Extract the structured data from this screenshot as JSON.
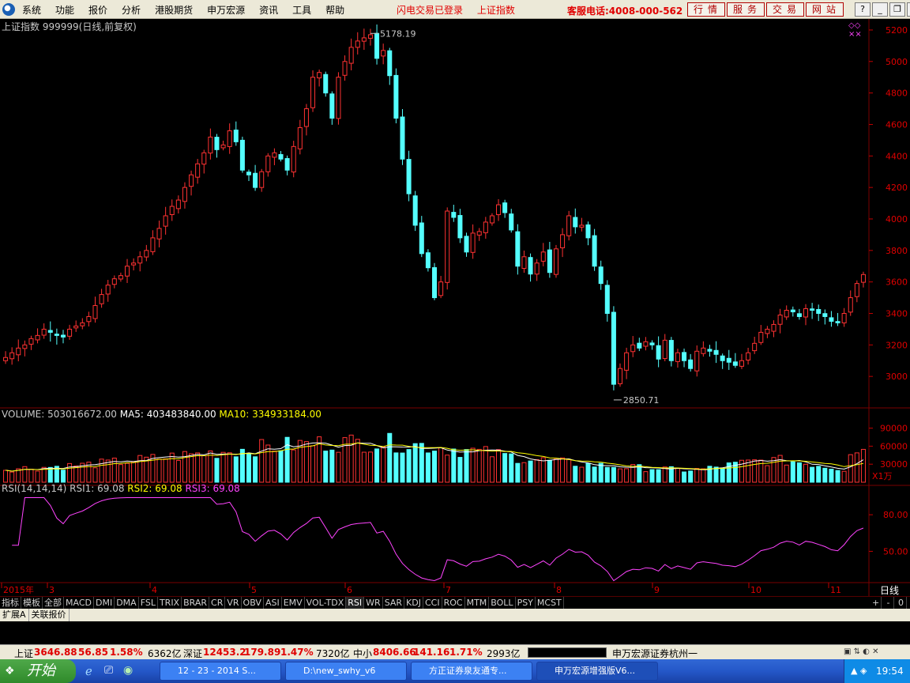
{
  "menu": [
    "系统",
    "功能",
    "报价",
    "分析",
    "港股期货",
    "申万宏源",
    "资讯",
    "工具",
    "帮助"
  ],
  "status_texts": [
    "闪电交易已登录",
    "上证指数"
  ],
  "hotline": "客服电话:4008-000-562",
  "top_buttons": [
    "行情",
    "服务",
    "交易",
    "网站"
  ],
  "window_controls": [
    "?",
    "_",
    "❐",
    "✕"
  ],
  "chart_header": {
    "title": "上证指数",
    "code": "999999(日线,前复权)",
    "high_label": "5178.19",
    "low_label": "2850.71"
  },
  "volume_header": {
    "volume": "VOLUME: 503016672.00",
    "ma5": "MA5: 403483840.00",
    "ma10": "MA10: 334933184.00",
    "unit": "X1万"
  },
  "rsi_header": {
    "name": "RSI(14,14,14)",
    "rsi1": "RSI1: 69.08",
    "rsi2": "RSI2: 69.08",
    "rsi3": "RSI3: 69.08"
  },
  "period_label": "日线",
  "colors": {
    "up": "#ff3232",
    "down": "#54ffff",
    "grid": "#7a0000",
    "rsi": "#ff44ff",
    "ma10": "#ffff00",
    "ma5": "#ffffff"
  },
  "tabs": [
    "指标",
    "模板",
    "全部",
    "MACD",
    "DMI",
    "DMA",
    "FSL",
    "TRIX",
    "BRAR",
    "CR",
    "VR",
    "OBV",
    "ASI",
    "EMV",
    "VOL-TDX",
    "RSI",
    "WR",
    "SAR",
    "KDJ",
    "CCI",
    "ROC",
    "MTM",
    "BOLL",
    "PSY",
    "MCST"
  ],
  "active_tab": "RSI",
  "tab_controls": [
    "+",
    "-",
    "0"
  ],
  "subtabs": [
    "扩展A",
    "关联报价"
  ],
  "statusbar": {
    "sh_label": "上证",
    "sh_value": "3646.88",
    "sh_change": "56.85",
    "sh_pct": "1.58%",
    "sh_amount": "6362亿",
    "sz_label": "深证",
    "sz_value": "12453.2",
    "sz_change": "179.89",
    "sz_pct": "1.47%",
    "sz_amount": "7320亿",
    "zx_label": "中小",
    "zx_value": "8406.66",
    "zx_change": "141.16",
    "zx_pct": "1.71%",
    "zx_amount": "2993亿",
    "broker": "申万宏源证券杭州一"
  },
  "taskbar": {
    "start": "开始",
    "windows": [
      "12 - 23 - 2014 S...",
      "D:\\new_swhy_v6",
      "方正证券泉友通专...",
      "申万宏源增强版V6..."
    ],
    "time": "19:54"
  },
  "chart_data": [
    {
      "type": "candlestick",
      "title": "上证指数 999999(日线,前复权)",
      "y_ticks": [
        3000,
        3200,
        3400,
        3600,
        3800,
        4000,
        4200,
        4400,
        4600,
        4800,
        5000,
        5200
      ],
      "ylim": [
        2800,
        5270
      ],
      "x_ticks": [
        "2015年",
        "3",
        "4",
        "5",
        "6",
        "7",
        "8",
        "9",
        "10",
        "11"
      ],
      "annotations": [
        {
          "label": "5178.19",
          "value": 5178.19
        },
        {
          "label": "2850.71",
          "value": 2850.71
        }
      ],
      "closes": [
        3120,
        3150,
        3180,
        3200,
        3240,
        3260,
        3300,
        3280,
        3260,
        3250,
        3300,
        3320,
        3340,
        3380,
        3450,
        3520,
        3580,
        3620,
        3640,
        3700,
        3720,
        3760,
        3800,
        3880,
        3940,
        4020,
        4080,
        4120,
        4200,
        4280,
        4350,
        4420,
        4520,
        4440,
        4470,
        4560,
        4490,
        4310,
        4280,
        4200,
        4300,
        4400,
        4420,
        4380,
        4310,
        4460,
        4580,
        4700,
        4900,
        4930,
        4800,
        4640,
        4900,
        5000,
        5090,
        5130,
        5150,
        5170,
        5020,
        5070,
        4910,
        4640,
        4380,
        4160,
        3960,
        3780,
        3690,
        3500,
        3600,
        4050,
        4010,
        3880,
        3790,
        3910,
        3920,
        3980,
        4020,
        4090,
        4040,
        3930,
        3700,
        3760,
        3650,
        3720,
        3790,
        3660,
        3810,
        3900,
        4020,
        3950,
        3960,
        3880,
        3700,
        3590,
        3400,
        2950,
        3050,
        3150,
        3200,
        3180,
        3220,
        3200,
        3110,
        3230,
        3100,
        3150,
        3100,
        3050,
        3160,
        3180,
        3160,
        3140,
        3100,
        3090,
        3070,
        3100,
        3150,
        3210,
        3280,
        3300,
        3330,
        3390,
        3420,
        3410,
        3380,
        3430,
        3420,
        3400,
        3380,
        3350,
        3340,
        3400,
        3500,
        3590,
        3646.88
      ],
      "volume_ticks": [
        30000,
        60000,
        90000
      ],
      "volume_unit": "X1万",
      "rsi_ticks": [
        50,
        80
      ],
      "rsi_last": 69.08
    }
  ]
}
